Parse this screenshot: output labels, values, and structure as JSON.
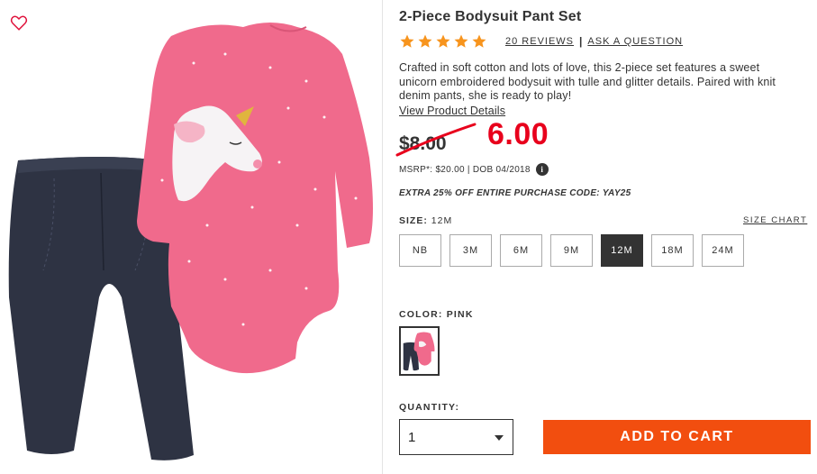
{
  "product": {
    "title": "2-Piece Bodysuit Pant Set",
    "rating": 5,
    "reviews_link": "20 REVIEWS",
    "separator": "|",
    "ask_link": "ASK A QUESTION",
    "description": "Crafted in soft cotton and lots of love, this 2-piece set features a sweet unicorn embroidered bodysuit with tulle and glitter details. Paired with knit denim pants, she is ready to play!",
    "view_details": "View Product Details"
  },
  "pricing": {
    "old_price": "$8.00",
    "new_price": "6.00",
    "msrp": "MSRP*: $20.00 | DOB 04/2018",
    "info_icon": "i",
    "promo": "EXTRA 25% OFF ENTIRE PURCHASE CODE: YAY25"
  },
  "size": {
    "label": "SIZE:",
    "selected": "12M",
    "chart_link": "SIZE CHART",
    "options": [
      "NB",
      "3M",
      "6M",
      "9M",
      "12M",
      "18M",
      "24M"
    ]
  },
  "color": {
    "label": "COLOR: PINK"
  },
  "quantity": {
    "label": "QUANTITY:",
    "value": "1"
  },
  "cart": {
    "button_label": "ADD TO CART"
  },
  "colors": {
    "star": "#f7941d",
    "add_to_cart": "#f24e0f",
    "sale_price": "#e8001c",
    "favorite": "#e0113b"
  },
  "icons": {
    "favorite": "heart-outline-icon",
    "rating": "star-icon",
    "info": "info-icon",
    "dropdown": "caret-down-icon"
  }
}
